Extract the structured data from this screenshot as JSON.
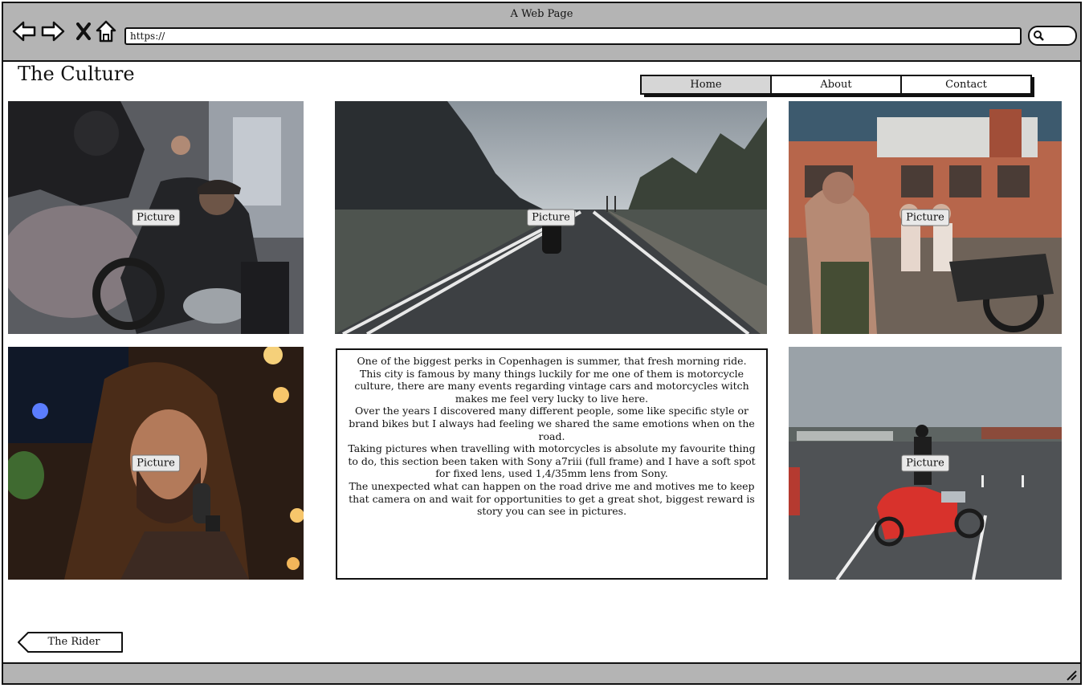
{
  "window": {
    "title": "A Web Page"
  },
  "browser": {
    "back_icon": "back-arrow-icon",
    "forward_icon": "forward-arrow-icon",
    "stop_icon": "close-icon",
    "home_icon": "home-icon",
    "url": "https://",
    "search_icon": "search-icon"
  },
  "site": {
    "title": "The Culture"
  },
  "nav": {
    "items": [
      {
        "label": "Home",
        "active": true
      },
      {
        "label": "About"
      },
      {
        "label": "Contact"
      }
    ]
  },
  "pictures": {
    "label": "Picture"
  },
  "article": {
    "paragraphs": [
      "One of the biggest perks in Copenhagen is summer, that fresh morning ride.",
      "This city is famous by many things luckily for me one of them is motorcycle culture, there are many events regarding vintage cars and motorcycles witch makes me feel very lucky to live here.",
      "Over the years I discovered many different people, some like specific style or brand bikes but I always had feeling we shared the same emotions when on the road.",
      "Taking pictures when travelling with motorcycles is absolute my favourite thing to do, this section been taken with Sony a7riii (full frame)  and I have a soft spot for fixed lens, used 1,4/35mm lens from Sony.",
      "The unexpected what can happen on the road drive me and motives me to keep that camera on and wait for opportunities to get a great shot, biggest reward is story you can see in pictures."
    ]
  },
  "footer": {
    "back_label": "The Rider"
  },
  "colors": {
    "chrome": "#b4b4b4",
    "active_tab": "#d6d6d6",
    "red_sidecar": "#d8322c"
  }
}
